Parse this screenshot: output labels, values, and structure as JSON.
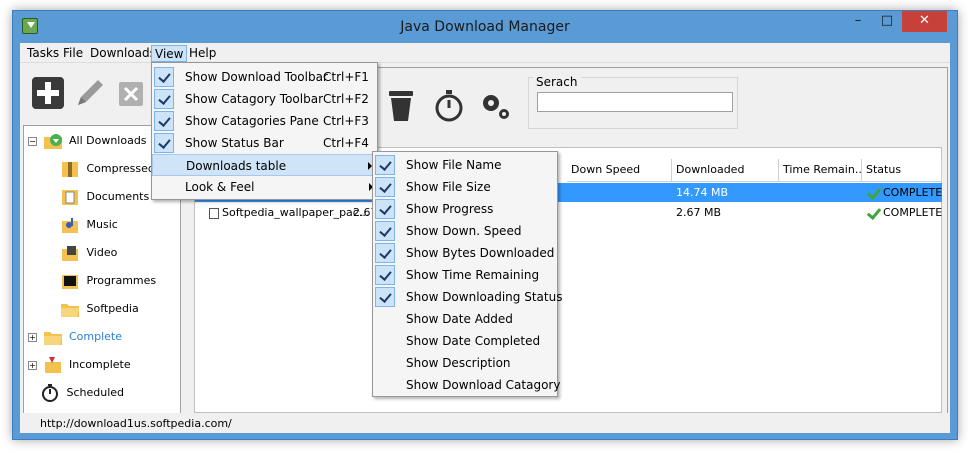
{
  "window": {
    "title": "Java Download Manager",
    "minimize": "–",
    "maximize": "□",
    "close": "✕"
  },
  "menubar": {
    "items": [
      "Tasks",
      "File",
      "Downloads",
      "View",
      "Help"
    ],
    "active": "View"
  },
  "toolbar": {
    "left_icons": [
      "add-icon",
      "edit-icon",
      "delete-icon"
    ],
    "right_icons": [
      "trash-icon",
      "stopwatch-icon",
      "settings-icon"
    ]
  },
  "search": {
    "label": "Serach",
    "value": ""
  },
  "tree": {
    "items": [
      {
        "label": "All Downloads",
        "icon": "all-downloads-icon"
      },
      {
        "label": "Compressed",
        "icon": "compressed-icon"
      },
      {
        "label": "Documents",
        "icon": "documents-icon"
      },
      {
        "label": "Music",
        "icon": "music-icon"
      },
      {
        "label": "Video",
        "icon": "video-icon"
      },
      {
        "label": "Programmes",
        "icon": "programmes-icon"
      },
      {
        "label": "Softpedia",
        "icon": "folder-icon"
      },
      {
        "label": "Complete",
        "icon": "complete-folder-icon"
      },
      {
        "label": "Incomplete",
        "icon": "incomplete-icon"
      },
      {
        "label": "Scheduled",
        "icon": "scheduled-icon"
      }
    ]
  },
  "table": {
    "columns": [
      "Down Speed",
      "Downloaded",
      "Time Remain...",
      "Status"
    ],
    "rows": [
      {
        "name": "",
        "size": "",
        "downloaded": "14.74 MB",
        "status": "COMPLETE",
        "selected": true
      },
      {
        "name": "Softpedia_wallpaper_pac...",
        "size": "2.67",
        "downloaded": "2.67 MB",
        "status": "COMPLETE",
        "selected": false
      }
    ]
  },
  "view_menu": {
    "items": [
      {
        "label": "Show Download Toolbar",
        "accel": "Ctrl+F1",
        "checked": true
      },
      {
        "label": "Show Catagory Toolbar",
        "accel": "Ctrl+F2",
        "checked": true
      },
      {
        "label": "Show Catagories Pane",
        "accel": "Ctrl+F3",
        "checked": true
      },
      {
        "label": "Show Status Bar",
        "accel": "Ctrl+F4",
        "checked": true
      },
      {
        "label": "Downloads table",
        "accel": "",
        "checked": false
      },
      {
        "label": "Look & Feel",
        "accel": "",
        "checked": false
      }
    ]
  },
  "table_submenu": {
    "items": [
      {
        "label": "Show File Name",
        "checked": true
      },
      {
        "label": "Show File Size",
        "checked": true
      },
      {
        "label": "Show Progress",
        "checked": true
      },
      {
        "label": "Show Down. Speed",
        "checked": true
      },
      {
        "label": "Show Bytes Downloaded",
        "checked": true
      },
      {
        "label": "Show Time Remaining",
        "checked": true
      },
      {
        "label": "Show Downloading Status",
        "checked": true
      },
      {
        "label": "Show Date Added",
        "checked": false
      },
      {
        "label": "Show Date Completed",
        "checked": false
      },
      {
        "label": "Show Description",
        "checked": false
      },
      {
        "label": "Show Download Catagory",
        "checked": false
      }
    ]
  },
  "statusbar": {
    "text": "http://download1us.softpedia.com/"
  }
}
